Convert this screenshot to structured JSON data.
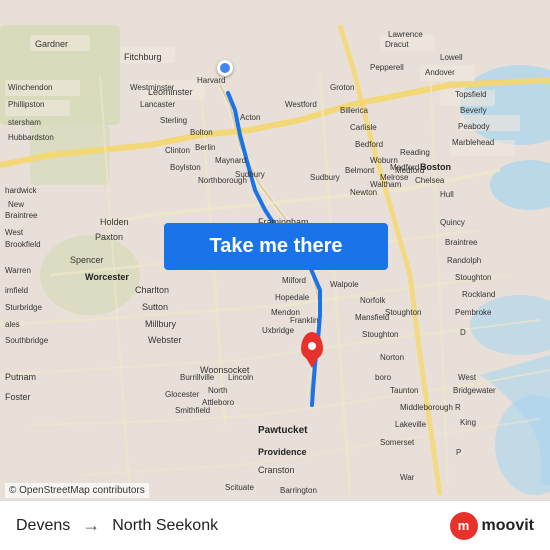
{
  "map": {
    "attribution": "© OpenStreetMap contributors",
    "background_color": "#e8e0d8"
  },
  "button": {
    "label": "Take me there"
  },
  "bottom_bar": {
    "from": "Devens",
    "to": "North Seekonk",
    "arrow": "→"
  },
  "moovit": {
    "text": "moovit",
    "icon_letter": "m"
  },
  "colors": {
    "button_bg": "#1a73e8",
    "origin_pin": "#4285f4",
    "dest_pin": "#e8312a",
    "moovit_red": "#e8312a"
  }
}
